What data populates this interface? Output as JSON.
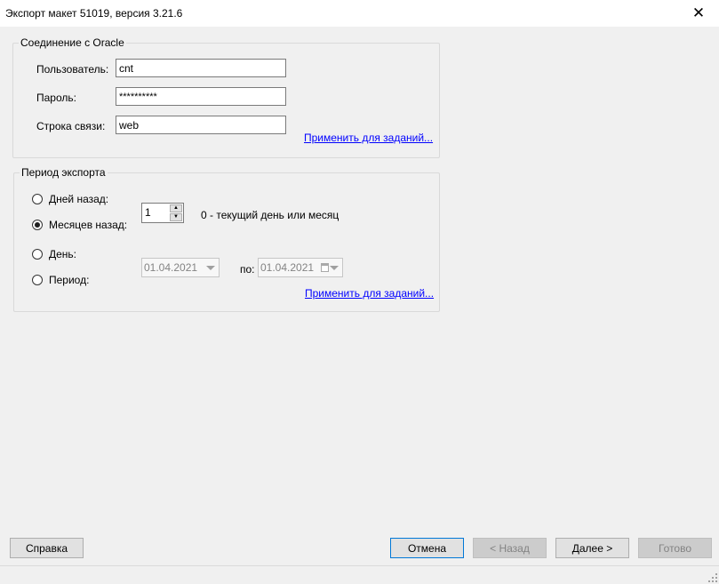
{
  "window": {
    "title": "Экспорт макет 51019, версия 3.21.6",
    "close_glyph": "✕"
  },
  "oracle_group": {
    "legend": "Соединение с Oracle",
    "user_label": "Пользователь:",
    "user_value": "cnt",
    "password_label": "Пароль:",
    "password_value": "**********",
    "connection_label": "Строка связи:",
    "connection_value": "web",
    "apply_link": "Применить для заданий..."
  },
  "period_group": {
    "legend": "Период экспорта",
    "radios": [
      {
        "label": "Дней назад:",
        "checked": false
      },
      {
        "label": "Месяцев назад:",
        "checked": true
      },
      {
        "label": "День:",
        "checked": false
      },
      {
        "label": "Период:",
        "checked": false
      }
    ],
    "months_value": "1",
    "hint": "0 - текущий день или месяц",
    "date_from": "01.04.2021",
    "to_label": "по:",
    "date_to": "01.04.2021",
    "apply_link": "Применить для заданий..."
  },
  "buttons": {
    "help": "Справка",
    "cancel": "Отмена",
    "back": "< Назад",
    "next": "Далее >",
    "finish": "Готово"
  }
}
